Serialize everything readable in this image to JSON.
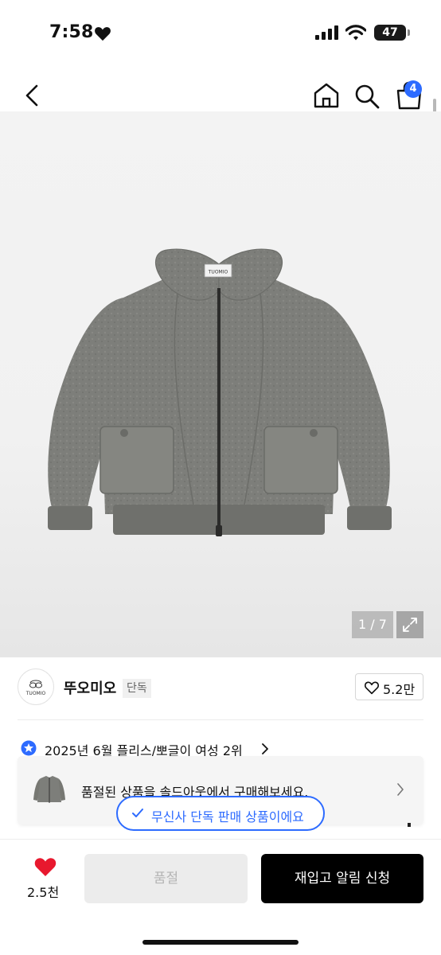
{
  "status_bar": {
    "time": "7:58",
    "battery": "47"
  },
  "header": {
    "cart_count": "4"
  },
  "gallery": {
    "counter": "1 / 7",
    "image_brand_label": "TUOMIO"
  },
  "brand": {
    "logo_text": "TUOMIO",
    "name": "뚜오미오",
    "tag": "단독",
    "likes": "5.2만"
  },
  "ranking": {
    "text": "2025년 6월 플리스/뽀글이 여성 2위"
  },
  "soldout_banner": {
    "text": "품절된 상품을 솔드아웃에서 구매해보세요."
  },
  "exclusive_pill": {
    "text": "무신사 단독 판매 상품이에요"
  },
  "bottom_bar": {
    "wish_count": "2.5천",
    "soldout_label": "품절",
    "restock_label": "재입고 알림 신청"
  },
  "colors": {
    "accent": "#2d6bff",
    "wish_heart": "#e8182e",
    "jacket": "#7d7e7a",
    "primary_button": "#000000"
  },
  "icons": [
    "heart-icon",
    "signal-icon",
    "wifi-icon",
    "battery-icon",
    "back-icon",
    "home-icon",
    "search-icon",
    "cart-icon",
    "expand-icon",
    "star-icon",
    "chevron-right-icon",
    "check-icon"
  ]
}
